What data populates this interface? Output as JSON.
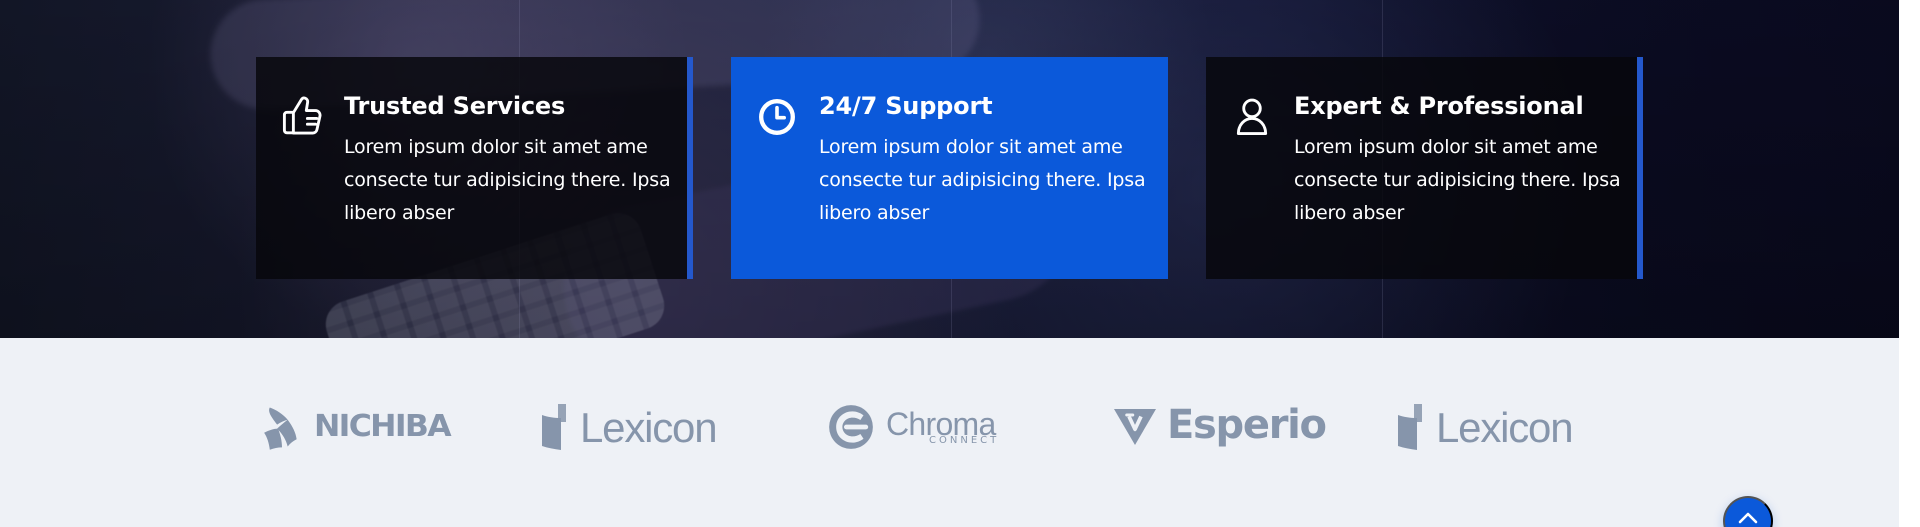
{
  "features": {
    "items": [
      {
        "icon": "thumbs-up-icon",
        "title": "Trusted Services",
        "text": "Lorem ipsum dolor sit amet ame consecte tur adipisicing there. Ipsa libero abser"
      },
      {
        "icon": "clock-icon",
        "title": "24/7 Support",
        "text": "Lorem ipsum dolor sit amet ame consecte tur adipisicing there. Ipsa libero abser"
      },
      {
        "icon": "user-icon",
        "title": "Expert & Professional",
        "text": "Lorem ipsum dolor sit amet ame consecte tur adipisicing there. Ipsa libero abser"
      }
    ]
  },
  "partners": {
    "logos": [
      {
        "name": "NICHIBA",
        "icon": "nichiba-logo-icon"
      },
      {
        "name": "Lexicon",
        "icon": "lexicon-logo-icon"
      },
      {
        "name": "Chroma",
        "subtitle": "CONNECT",
        "icon": "chroma-logo-icon"
      },
      {
        "name": "Esperio",
        "icon": "esperio-logo-icon"
      },
      {
        "name": "Lexicon",
        "icon": "lexicon-logo-icon"
      }
    ]
  },
  "actions": {
    "scroll_top_icon": "chevron-up-icon"
  },
  "colors": {
    "accent_blue": "#0b59da",
    "dark_card": "#07070c",
    "logo_gray": "#8191a7",
    "band_bg": "#eef1f6",
    "white": "#ffffff"
  }
}
